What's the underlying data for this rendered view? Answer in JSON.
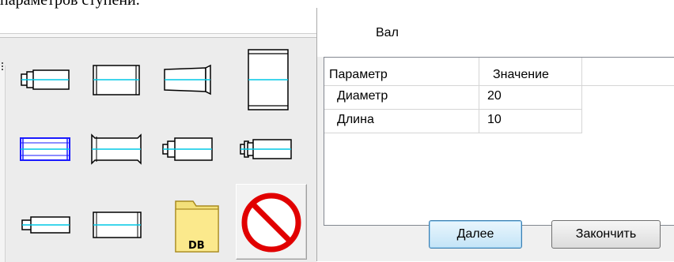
{
  "page": {
    "top_text": "параметров ступени."
  },
  "toolbar": {
    "icons": [
      {
        "name": "shaft-step-small-end-icon"
      },
      {
        "name": "shaft-cylinder-icon"
      },
      {
        "name": "shaft-tapered-icon"
      },
      {
        "name": "shaft-large-cylinder-icon"
      },
      {
        "name": "shaft-selected-cylinder-icon"
      },
      {
        "name": "shaft-chamfered-icon"
      },
      {
        "name": "shaft-step-both-icon"
      },
      {
        "name": "shaft-step-flanged-icon"
      },
      {
        "name": "shaft-step-long-icon"
      },
      {
        "name": "shaft-plain-icon"
      },
      {
        "name": "database-folder-icon"
      },
      {
        "name": "cancel-icon"
      }
    ],
    "db_label": "DB"
  },
  "dialog": {
    "title": "Вал",
    "table": {
      "headers": [
        "Параметр",
        "Значение"
      ],
      "rows": [
        {
          "param": "Диаметр",
          "value": "20"
        },
        {
          "param": "Длина",
          "value": "10"
        }
      ]
    },
    "next_label": "Далее",
    "finish_label": "Закончить"
  },
  "colors": {
    "axis": "#00c8e6",
    "selection": "#1a1aff",
    "cancel": "#e10000"
  }
}
